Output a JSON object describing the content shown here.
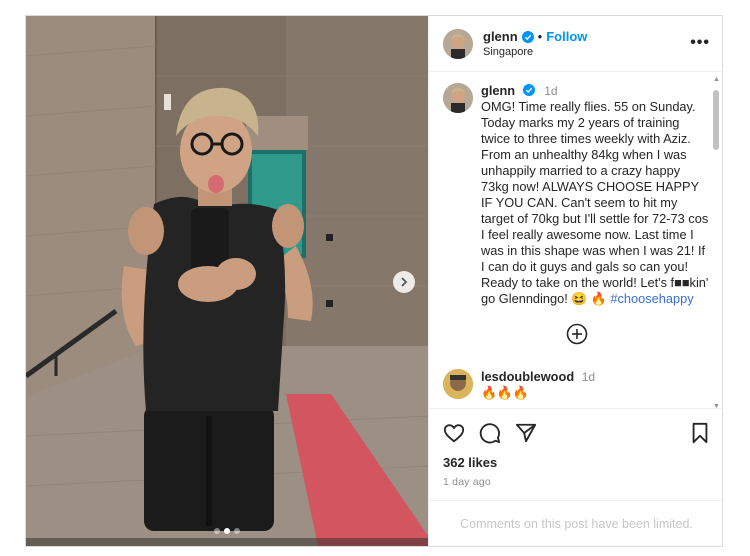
{
  "media": {
    "carousel_dots": 3,
    "active_dot": 1
  },
  "author": {
    "username": "glenn",
    "follow_label": "Follow",
    "separator": "•",
    "location": "Singapore",
    "more_label": "•••"
  },
  "caption": {
    "username": "glenn",
    "time": "1d",
    "text": "OMG! Time really flies. 55 on Sunday. Today marks my 2 years of training twice to three times weekly with Aziz. From an unhealthy 84kg when I was unhappily married to a crazy happy 73kg now! ALWAYS CHOOSE HAPPY IF YOU CAN. Can't seem to hit my target of 70kg but I'll settle for 72-73 cos I feel really awesome now. Last time I was in this shape was when I was 21! If I can do it guys and gals so can you! Ready to take on the world! Let's f■■kin' go Glenndingo! 😆 🔥 ",
    "hashtag": "#choosehappy"
  },
  "comments": [
    {
      "username": "lesdoublewood",
      "time": "1d",
      "text": "🔥🔥🔥"
    }
  ],
  "likes": "362 likes",
  "time_ago": "1 day ago",
  "comments_limited": "Comments on this post have been limited.",
  "colors": {
    "accent": "#0095f6",
    "hashtag": "#3a6dd3",
    "muted": "#8e8e8e"
  }
}
